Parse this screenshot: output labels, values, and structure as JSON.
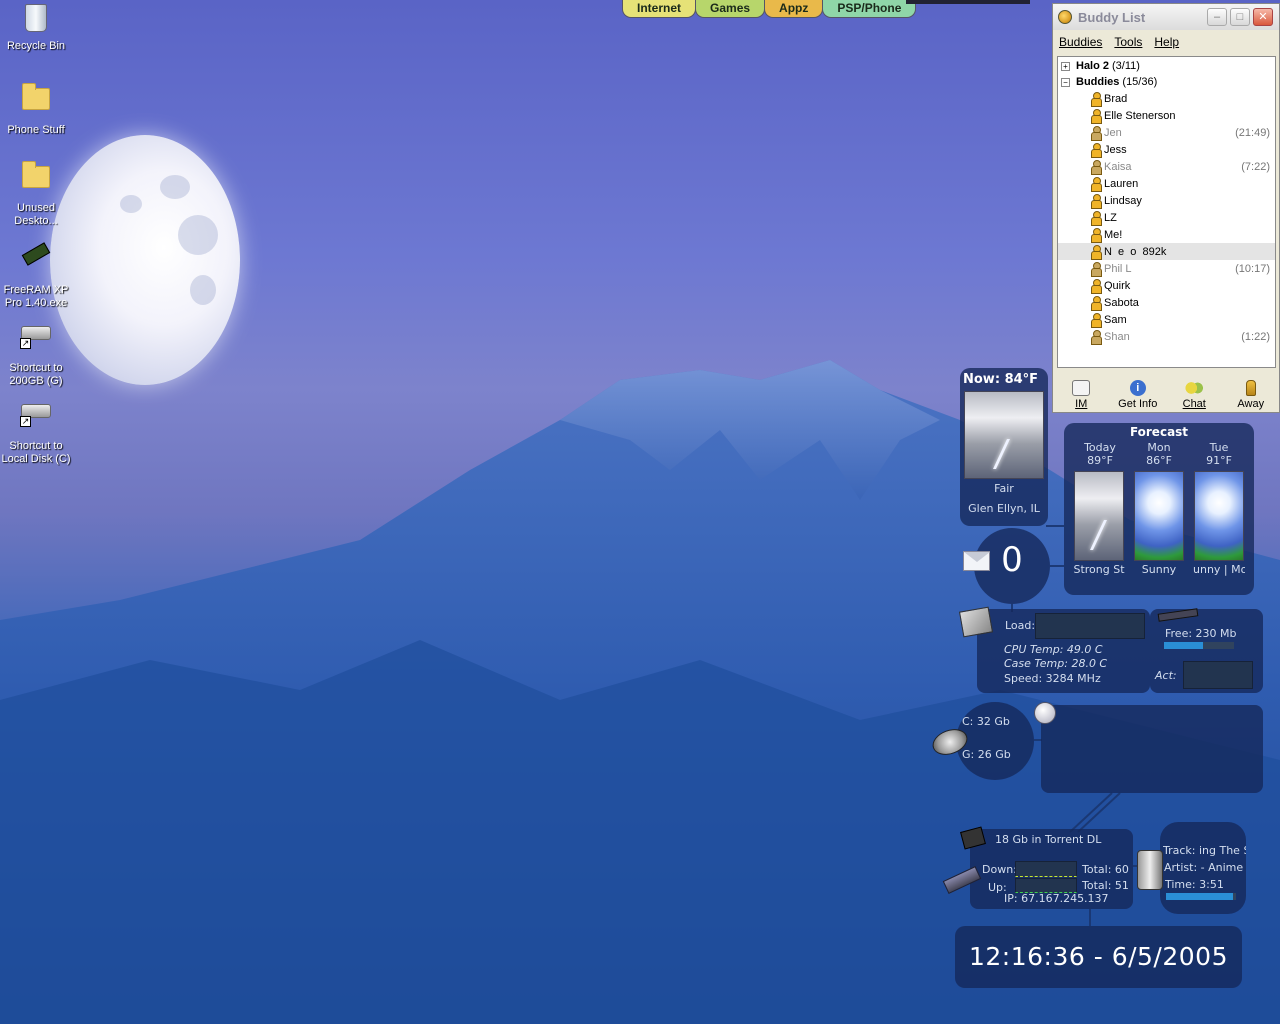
{
  "desktop": {
    "icons": [
      {
        "label": "Recycle Bin",
        "icon": "recycle-bin-icon"
      },
      {
        "label": "Phone Stuff",
        "icon": "folder-icon"
      },
      {
        "label": "Unused Deskto...",
        "icon": "folder-icon"
      },
      {
        "label": "FreeRAM XP Pro 1.40.exe",
        "icon": "ram-chip-icon"
      },
      {
        "label": "Shortcut to 200GB (G)",
        "icon": "hard-drive-icon"
      },
      {
        "label": "Shortcut to Local Disk (C)",
        "icon": "hard-drive-icon"
      }
    ]
  },
  "quick_launch": {
    "tabs": [
      {
        "label": "Internet",
        "color": "#e6e277"
      },
      {
        "label": "Games",
        "color": "#b7d66b"
      },
      {
        "label": "Appz",
        "color": "#e9b94a"
      },
      {
        "label": "PSP/Phone",
        "color": "#8fd6a8"
      }
    ]
  },
  "buddy_list": {
    "title": "Buddy List",
    "menu": [
      "Buddies",
      "Tools",
      "Help"
    ],
    "groups": [
      {
        "name": "Halo 2",
        "count": "(3/11)",
        "expanded": false
      },
      {
        "name": "Buddies",
        "count": "(15/36)",
        "expanded": true
      }
    ],
    "buddies": [
      {
        "name": "Brad",
        "idle": ""
      },
      {
        "name": "Elle Stenerson",
        "idle": ""
      },
      {
        "name": "Jen",
        "idle": "(21:49)"
      },
      {
        "name": "Jess",
        "idle": ""
      },
      {
        "name": "Kaisa",
        "idle": "(7:22)"
      },
      {
        "name": "Lauren",
        "idle": ""
      },
      {
        "name": "Lindsay",
        "idle": ""
      },
      {
        "name": "LZ",
        "idle": ""
      },
      {
        "name": "Me!",
        "idle": ""
      },
      {
        "name": "N  e  o  892k",
        "idle": ""
      },
      {
        "name": "Phil L",
        "idle": "(10:17)"
      },
      {
        "name": "Quirk",
        "idle": ""
      },
      {
        "name": "Sabota",
        "idle": ""
      },
      {
        "name": "Sam",
        "idle": ""
      },
      {
        "name": "Shan",
        "idle": "(1:22)"
      }
    ],
    "toolbar": [
      "IM",
      "Get Info",
      "Chat",
      "Away"
    ]
  },
  "weather": {
    "now_label": "Now:",
    "now_temp": "84°F",
    "condition": "Fair",
    "location": "Glen Ellyn, IL",
    "forecast_title": "Forecast",
    "forecast": [
      {
        "day": "Today",
        "temp": "89°F",
        "cond": "Strong St"
      },
      {
        "day": "Mon",
        "temp": "86°F",
        "cond": "Sunny"
      },
      {
        "day": "Tue",
        "temp": "91°F",
        "cond": "unny | Mo"
      }
    ]
  },
  "mail": {
    "count": "0"
  },
  "system": {
    "load_label": "Load:",
    "cpu_temp": "CPU Temp: 49.0 C",
    "case_temp": "Case Temp: 28.0 C",
    "speed": "Speed: 3284 MHz",
    "free_ram": "Free: 230 Mb",
    "free_ram_fraction": 0.55,
    "act_label": "Act:"
  },
  "disks": {
    "c": "C: 32 Gb",
    "g": "G: 26 Gb"
  },
  "network": {
    "torrent": "18 Gb in Torrent DL",
    "down_label": "Down:",
    "up_label": "Up:",
    "total_down": "Total: 60",
    "total_up": "Total: 51",
    "ip": "IP: 67.167.245.137"
  },
  "music": {
    "track": "Track: ing The S",
    "artist": "Artist: -   Anime",
    "time": "Time: 3:51",
    "progress_fraction": 0.95
  },
  "clock": {
    "text": "12:16:36 - 6/5/2005"
  }
}
